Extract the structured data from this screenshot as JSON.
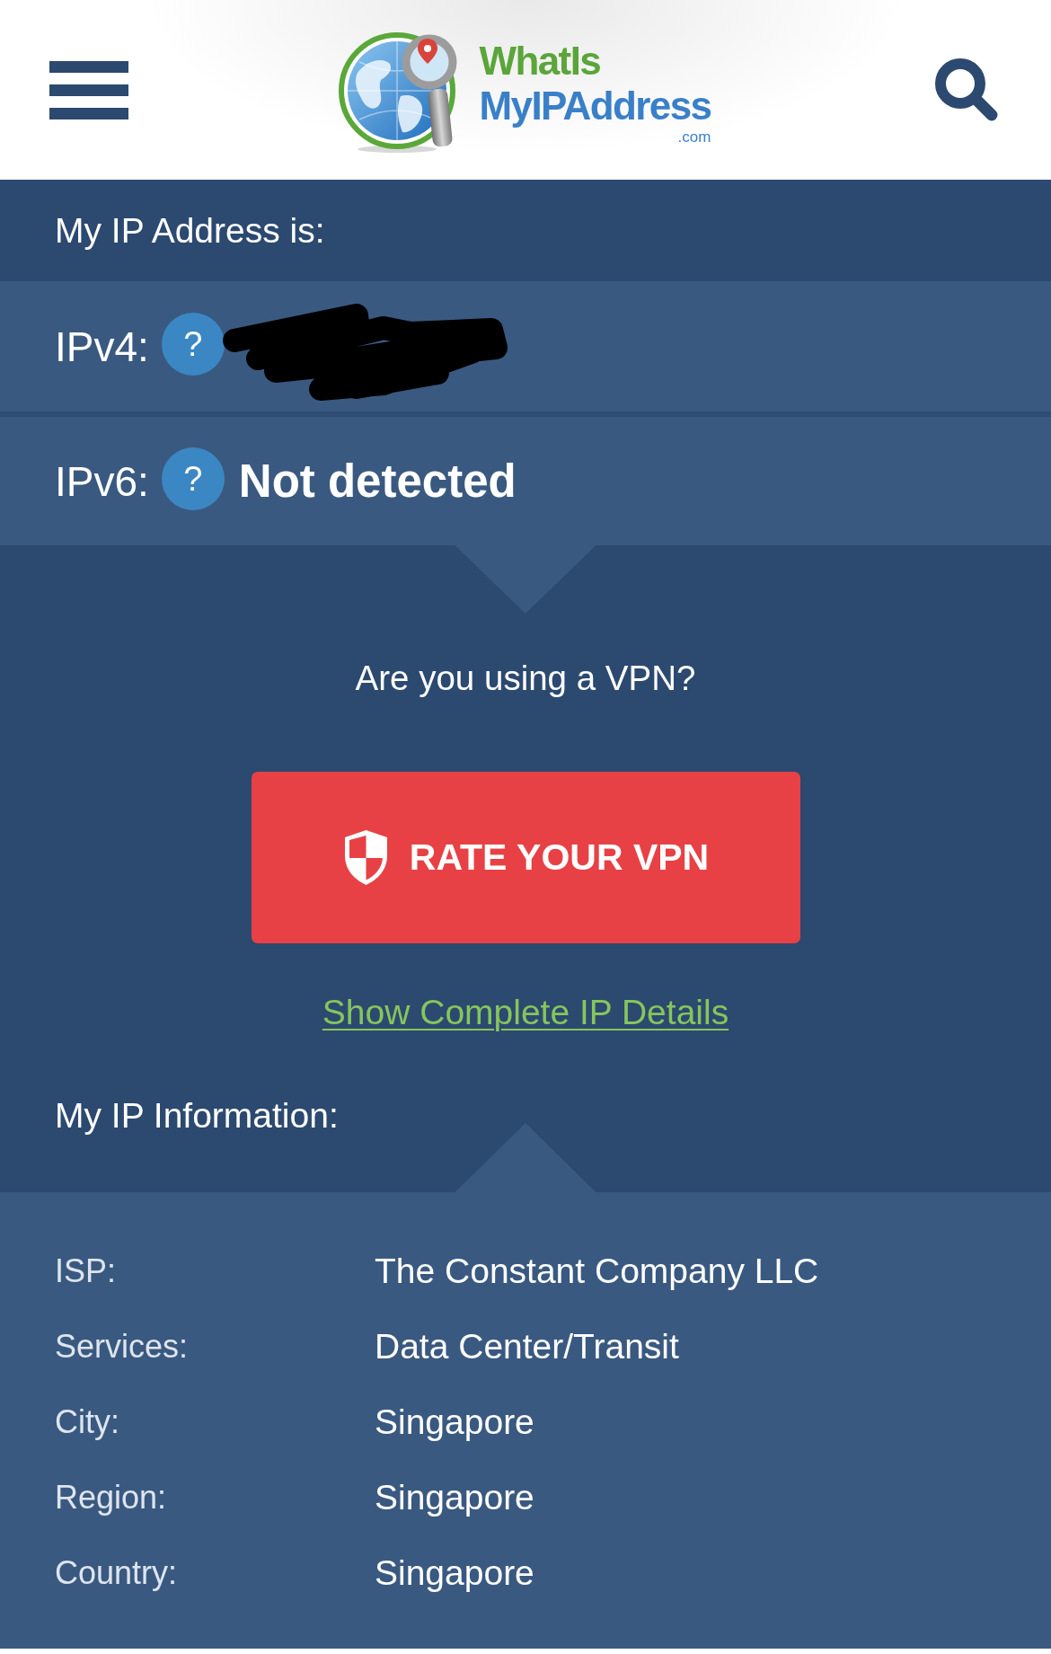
{
  "header": {
    "logo": {
      "line_1": "WhatIs",
      "line_2": "MyIPAddress",
      "suffix": ".com"
    }
  },
  "address": {
    "title": "My IP Address is:",
    "rows": [
      {
        "label": "IPv4:",
        "help": "?",
        "kind": "redacted"
      },
      {
        "label": "IPv6:",
        "help": "?",
        "kind": "text",
        "value": "Not detected"
      }
    ]
  },
  "vpn": {
    "question": "Are you using a VPN?",
    "button": "RATE YOUR VPN",
    "link": "Show Complete IP Details"
  },
  "info": {
    "title": "My IP Information:",
    "rows": [
      {
        "label": "ISP:",
        "value": "The Constant Company LLC"
      },
      {
        "label": "Services:",
        "value": "Data Center/Transit"
      },
      {
        "label": "City:",
        "value": "Singapore"
      },
      {
        "label": "Region:",
        "value": "Singapore"
      },
      {
        "label": "Country:",
        "value": "Singapore"
      }
    ]
  }
}
